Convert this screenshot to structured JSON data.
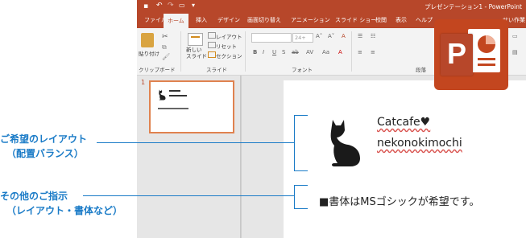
{
  "window": {
    "title": "プレゼンテーション1 - PowerPoint"
  },
  "tabs": [
    {
      "label": "ファイル",
      "active": false
    },
    {
      "label": "ホーム",
      "active": true
    },
    {
      "label": "挿入",
      "active": false
    },
    {
      "label": "デザイン",
      "active": false
    },
    {
      "label": "画面切り替え",
      "active": false
    },
    {
      "label": "アニメーション",
      "active": false
    },
    {
      "label": "スライド ショー",
      "active": false
    },
    {
      "label": "校閲",
      "active": false
    },
    {
      "label": "表示",
      "active": false
    },
    {
      "label": "ヘルプ",
      "active": false
    },
    {
      "label": "せい作業",
      "active": false
    }
  ],
  "ribbon": {
    "paste_label": "貼り付け",
    "clipboard_group": "クリップボード",
    "new_slide_label": "新しい\nスライド",
    "layout_label": "レイアウト",
    "reset_label": "リセット",
    "section_label": "セクション",
    "slides_group": "スライド",
    "font_size": "24+",
    "font_group": "フォント",
    "paragraph_group": "段落",
    "format_buttons": [
      "B",
      "I",
      "U",
      "S",
      "ab",
      "AV",
      "Aa",
      "A"
    ]
  },
  "thumbnail": {
    "number": "1"
  },
  "slide": {
    "title_line1": "Catcafe♥",
    "title_line2": "nekonokimochi",
    "body_text": "■書体はMSゴシックが希望です。"
  },
  "callouts": {
    "layout_line1": "ご希望のレイアウト",
    "layout_line2": "（配置バランス）",
    "other_line1": "その他のご指示",
    "other_line2": "（レイアウト・書体など）"
  },
  "logo": {
    "letter": "P"
  },
  "colors": {
    "accent": "#b7472a",
    "callout": "#1a7bc7",
    "logo": "#c3461f"
  }
}
